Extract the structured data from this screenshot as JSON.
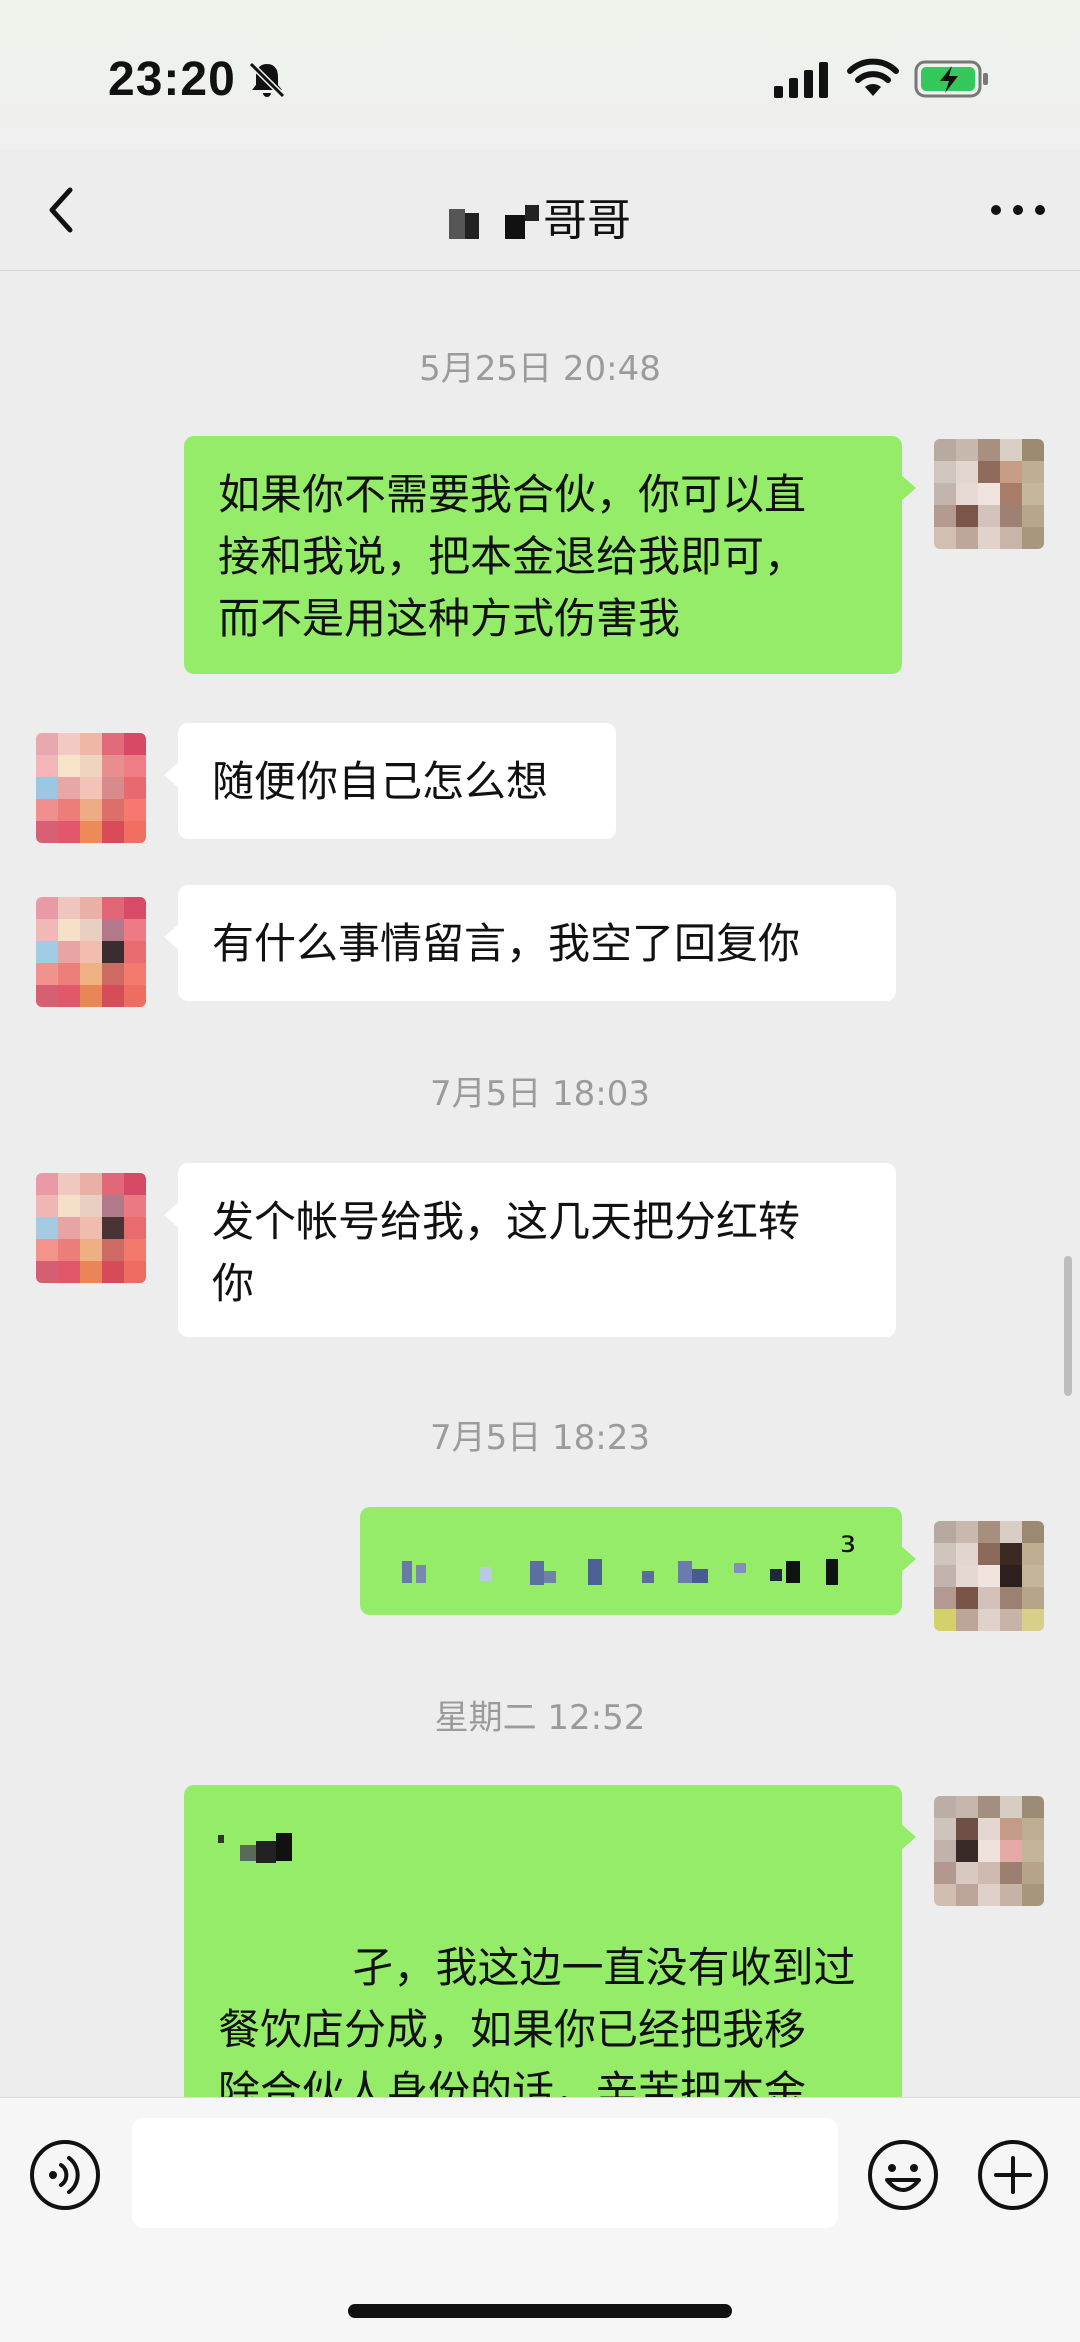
{
  "status_bar": {
    "time": "23:20"
  },
  "header": {
    "title": "哥哥",
    "back_icon": "chevron-left-icon",
    "more_icon": "ellipsis-icon"
  },
  "messages": [
    {
      "type": "timestamp",
      "text": "5月25日 20:48"
    },
    {
      "type": "sent",
      "text": "如果你不需要我合伙，你可以直\n接和我说，把本金退给我即可，\n而不是用这种方式伤害我"
    },
    {
      "type": "received",
      "text": "随便你自己怎么想"
    },
    {
      "type": "received",
      "text": "有什么事情留言，我空了回复你"
    },
    {
      "type": "timestamp",
      "text": "7月5日 18:03"
    },
    {
      "type": "received",
      "text": "发个帐号给我，这几天把分红转\n你"
    },
    {
      "type": "timestamp",
      "text": "7月5日 18:23"
    },
    {
      "type": "sent",
      "text": "³"
    },
    {
      "type": "timestamp",
      "text": "星期二 12:52"
    },
    {
      "type": "sent",
      "text": "      孑，我这边一直没有收到过\n餐饮店分成，如果你已经把我移\n除合伙人身份的话，辛苦把本金\n退还给我，我妈还在医院住着，\n今年陆陆续续也花了好几万，今"
    }
  ],
  "input_bar": {
    "placeholder": "",
    "voice_icon": "voice-icon",
    "emoji_icon": "emoji-icon",
    "plus_icon": "plus-icon"
  },
  "colors": {
    "sent_bubble": "#95ec69",
    "received_bubble": "#ffffff",
    "background": "#ededed"
  }
}
